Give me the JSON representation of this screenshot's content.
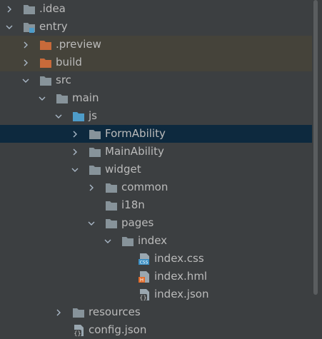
{
  "tree": {
    "items": [
      {
        "label": ".idea",
        "depth": 0,
        "arrow": "right",
        "icon": "folder-icon",
        "state": "normal"
      },
      {
        "label": "entry",
        "depth": 0,
        "arrow": "down",
        "icon": "module-folder-icon",
        "state": "normal"
      },
      {
        "label": ".preview",
        "depth": 1,
        "arrow": "right",
        "icon": "excluded-folder-icon",
        "state": "excluded"
      },
      {
        "label": "build",
        "depth": 1,
        "arrow": "right",
        "icon": "excluded-folder-icon",
        "state": "excluded"
      },
      {
        "label": "src",
        "depth": 1,
        "arrow": "down",
        "icon": "folder-icon",
        "state": "normal"
      },
      {
        "label": "main",
        "depth": 2,
        "arrow": "down",
        "icon": "folder-icon",
        "state": "normal"
      },
      {
        "label": "js",
        "depth": 3,
        "arrow": "down",
        "icon": "source-folder-icon",
        "state": "normal"
      },
      {
        "label": "FormAbility",
        "depth": 4,
        "arrow": "right",
        "icon": "folder-icon",
        "state": "selected"
      },
      {
        "label": "MainAbility",
        "depth": 4,
        "arrow": "right",
        "icon": "folder-icon",
        "state": "normal"
      },
      {
        "label": "widget",
        "depth": 4,
        "arrow": "down",
        "icon": "folder-icon",
        "state": "normal"
      },
      {
        "label": "common",
        "depth": 5,
        "arrow": "right",
        "icon": "folder-icon",
        "state": "normal"
      },
      {
        "label": "i18n",
        "depth": 5,
        "arrow": "none",
        "icon": "folder-icon",
        "state": "normal"
      },
      {
        "label": "pages",
        "depth": 5,
        "arrow": "down",
        "icon": "folder-icon",
        "state": "normal"
      },
      {
        "label": "index",
        "depth": 6,
        "arrow": "down",
        "icon": "folder-icon",
        "state": "normal"
      },
      {
        "label": "index.css",
        "depth": 7,
        "arrow": "none",
        "icon": "css-file-icon",
        "state": "normal"
      },
      {
        "label": "index.hml",
        "depth": 7,
        "arrow": "none",
        "icon": "html-file-icon",
        "state": "normal"
      },
      {
        "label": "index.json",
        "depth": 7,
        "arrow": "none",
        "icon": "json-file-icon",
        "state": "normal"
      },
      {
        "label": "resources",
        "depth": 3,
        "arrow": "right",
        "icon": "folder-icon",
        "state": "normal"
      },
      {
        "label": "config.json",
        "depth": 3,
        "arrow": "none",
        "icon": "json-file-icon",
        "state": "normal"
      }
    ]
  },
  "colors": {
    "background": "#3c3f41",
    "text": "#bbbbbb",
    "folder": "#87939a",
    "source_folder": "#4e9cc9",
    "excluded_folder": "#c86a3a",
    "selected_row": "#0d293e",
    "excluded_row": "#45433a"
  }
}
